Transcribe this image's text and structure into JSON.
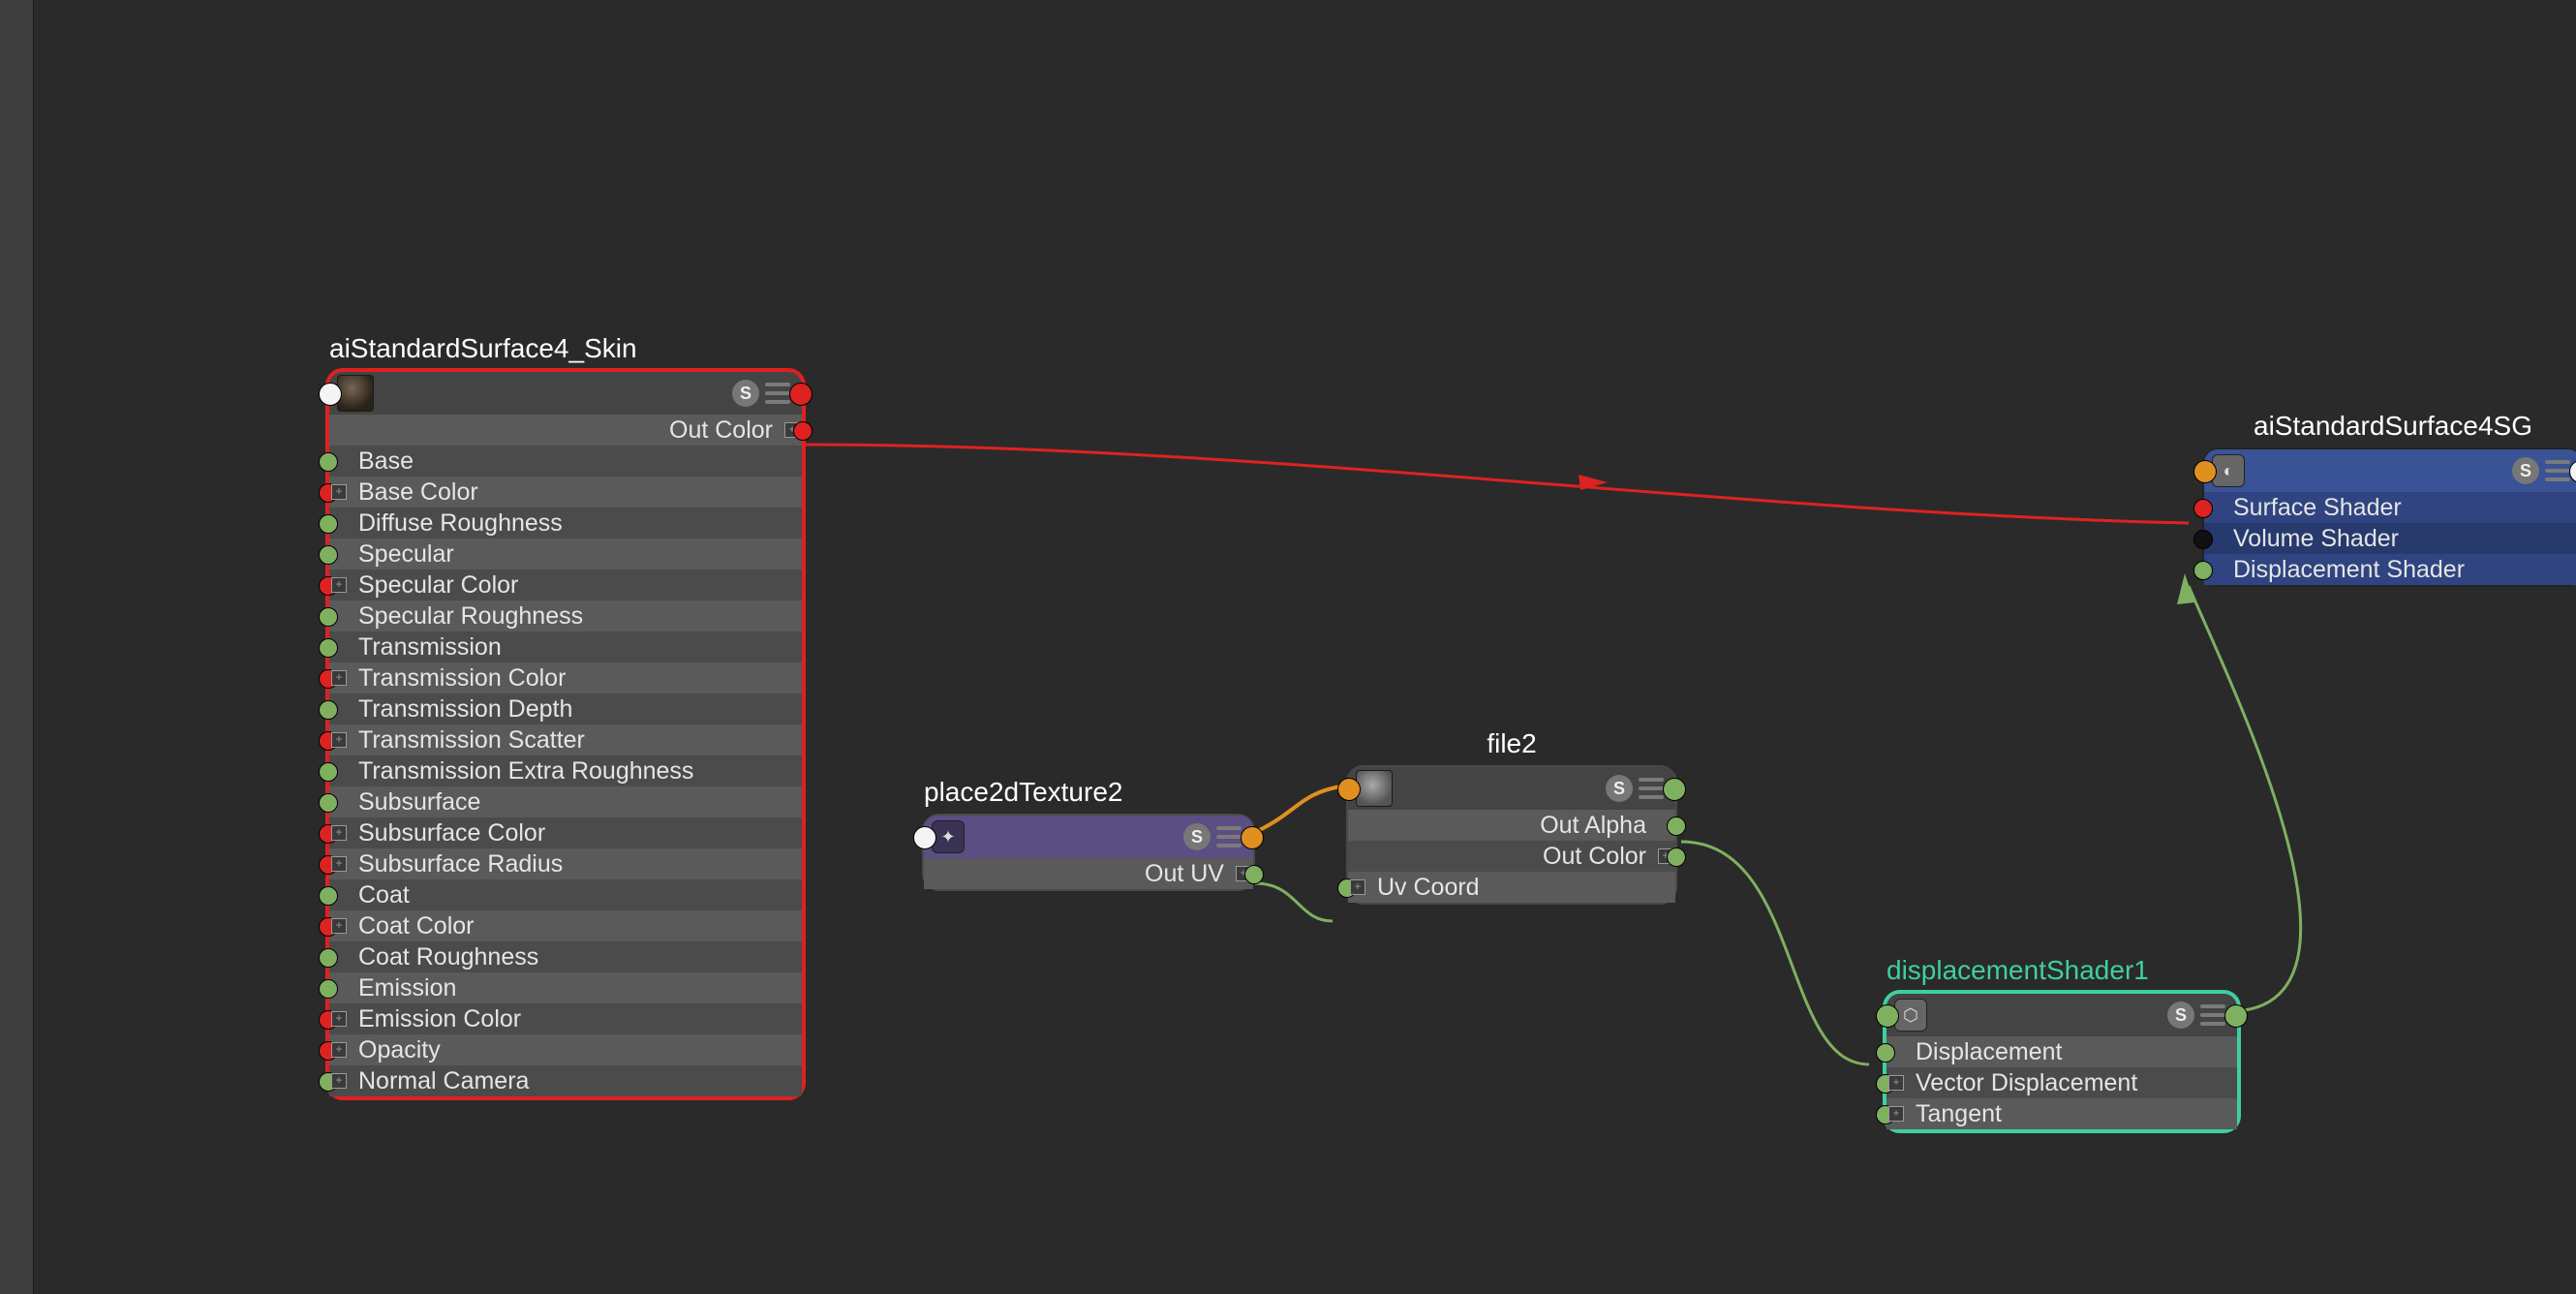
{
  "nodes": {
    "standardSurface": {
      "title": "aiStandardSurface4_Skin",
      "outputs": [
        "Out Color"
      ],
      "inputs": [
        {
          "label": "Base",
          "port": "green"
        },
        {
          "label": "Base Color",
          "port": "red",
          "expand": true
        },
        {
          "label": "Diffuse Roughness",
          "port": "green"
        },
        {
          "label": "Specular",
          "port": "green"
        },
        {
          "label": "Specular Color",
          "port": "red",
          "expand": true
        },
        {
          "label": "Specular Roughness",
          "port": "green"
        },
        {
          "label": "Transmission",
          "port": "green"
        },
        {
          "label": "Transmission Color",
          "port": "red",
          "expand": true
        },
        {
          "label": "Transmission Depth",
          "port": "green"
        },
        {
          "label": "Transmission Scatter",
          "port": "red",
          "expand": true
        },
        {
          "label": "Transmission Extra Roughness",
          "port": "green"
        },
        {
          "label": "Subsurface",
          "port": "green"
        },
        {
          "label": "Subsurface Color",
          "port": "red",
          "expand": true
        },
        {
          "label": "Subsurface Radius",
          "port": "red",
          "expand": true
        },
        {
          "label": "Coat",
          "port": "green"
        },
        {
          "label": "Coat Color",
          "port": "red",
          "expand": true
        },
        {
          "label": "Coat Roughness",
          "port": "green"
        },
        {
          "label": "Emission",
          "port": "green"
        },
        {
          "label": "Emission Color",
          "port": "red",
          "expand": true
        },
        {
          "label": "Opacity",
          "port": "red",
          "expand": true
        },
        {
          "label": "Normal Camera",
          "port": "green",
          "expand": true
        }
      ]
    },
    "shadingGroup": {
      "title": "aiStandardSurface4SG",
      "inputs": [
        {
          "label": "Surface Shader",
          "port": "red"
        },
        {
          "label": "Volume Shader",
          "port": "black"
        },
        {
          "label": "Displacement Shader",
          "port": "green"
        }
      ]
    },
    "place2d": {
      "title": "place2dTexture2",
      "outputs": [
        "Out UV"
      ]
    },
    "file": {
      "title": "file2",
      "outputs": [
        "Out Alpha",
        "Out Color"
      ],
      "inputs": [
        {
          "label": "Uv Coord",
          "port": "green",
          "expand": true
        }
      ]
    },
    "displacement": {
      "title": "displacementShader1",
      "inputs": [
        {
          "label": "Displacement",
          "port": "green"
        },
        {
          "label": "Vector Displacement",
          "port": "green",
          "expand": true
        },
        {
          "label": "Tangent",
          "port": "green",
          "expand": true
        }
      ]
    }
  }
}
